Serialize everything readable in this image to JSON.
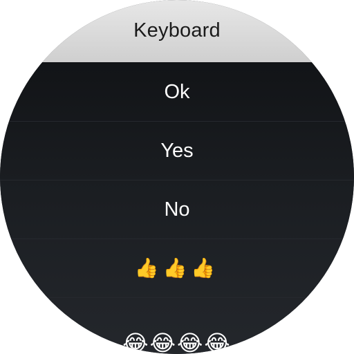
{
  "header": {
    "title": "Keyboard"
  },
  "replies": [
    {
      "label": "Ok"
    },
    {
      "label": "Yes"
    },
    {
      "label": "No"
    },
    {
      "label": "👍👍👍"
    },
    {
      "label": "😂😂😂😂"
    }
  ],
  "colors": {
    "header_bg": "#d6d6d6",
    "header_text": "#1a1a1a",
    "list_bg": "#1c1f23",
    "item_text": "#ffffff",
    "divider": "#26292e"
  }
}
